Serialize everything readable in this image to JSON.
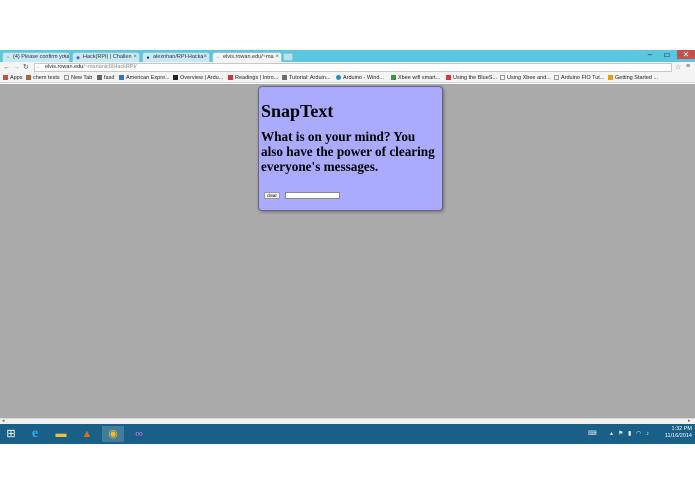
{
  "browser": {
    "tabs": [
      {
        "label": "(4) Please confirm your",
        "icon": "page-icon"
      },
      {
        "label": "Hack(RPI) | Challen",
        "icon": "devpost-icon"
      },
      {
        "label": "alexnhan/RPI-Hacka",
        "icon": "github-icon"
      },
      {
        "label": "elvis.rowan.edu/~ma",
        "icon": "page-icon"
      }
    ],
    "window_controls": {
      "minimize": "‒",
      "maximize": "▭",
      "close": "✕"
    },
    "nav": {
      "back": "←",
      "forward": "→",
      "reload": "↻"
    },
    "url": {
      "host": "elvis.rowan.edu",
      "path": "/~marianic0/HackRPI/"
    },
    "bookmarks": [
      {
        "label": "Apps",
        "color": "#d24b3c"
      },
      {
        "label": "chem tests",
        "color": "#9c6a3c"
      },
      {
        "label": "New Tab",
        "color": "#cccccc"
      },
      {
        "label": "fasd",
        "color": "#666666"
      },
      {
        "label": "American Expre...",
        "color": "#2a7ac9"
      },
      {
        "label": "Overview | Ardu...",
        "color": "#222222"
      },
      {
        "label": "Readings | Intro...",
        "color": "#c83a3a"
      },
      {
        "label": "Tutorial: Arduin...",
        "color": "#6c6c6c"
      },
      {
        "label": "Arduino - Wind...",
        "color": "#2a8fb8"
      },
      {
        "label": "Xbee wifi smart...",
        "color": "#3a9a3a"
      },
      {
        "label": "Using the BlueS...",
        "color": "#d23c3c"
      },
      {
        "label": "Using Xbee and...",
        "color": "#cccccc"
      },
      {
        "label": "Arduino FIO Tut...",
        "color": "#cccccc"
      },
      {
        "label": "Getting Started ...",
        "color": "#e0a020"
      }
    ]
  },
  "page": {
    "title": "SnapText",
    "message": "What is on your mind? You also have the power of clearing everyone's messages.",
    "clear_label": "clear",
    "input_value": ""
  },
  "colors": {
    "card_bg": "#aaaaff",
    "page_bg": "#aaaaaa",
    "titlebar": "#5ac6df",
    "taskbar": "#1a5f86"
  },
  "taskbar": {
    "apps": [
      {
        "name": "start-icon",
        "glyph": "⊞"
      },
      {
        "name": "internet-explorer-icon",
        "glyph": "e"
      },
      {
        "name": "file-explorer-icon",
        "glyph": "▬"
      },
      {
        "name": "matlab-icon",
        "glyph": "▲"
      },
      {
        "name": "chrome-icon",
        "glyph": "◉"
      },
      {
        "name": "visual-studio-icon",
        "glyph": "∞"
      }
    ],
    "clock_time": "1:32 PM",
    "clock_date": "11/16/2014"
  }
}
